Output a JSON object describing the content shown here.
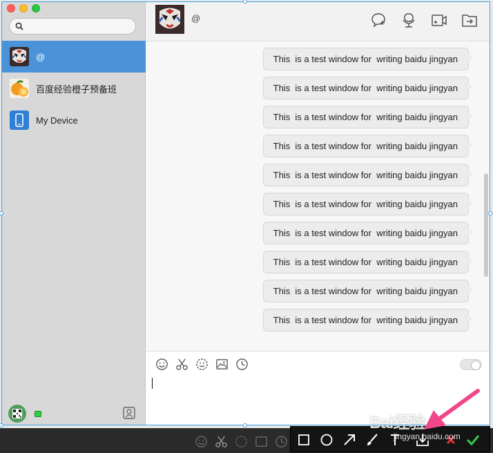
{
  "window": {
    "traffic_lights": [
      "#ff5f57",
      "#febc2e",
      "#28c840"
    ],
    "accent": "#4a93d9"
  },
  "sidebar": {
    "search": {
      "placeholder": "",
      "icon": "search-icon"
    },
    "chats": [
      {
        "name": "@",
        "avatar": "opera-mask-avatar",
        "active": true
      },
      {
        "name": "百度经验橙子预备班",
        "avatar": "orange-avatar",
        "active": false
      },
      {
        "name": "My Device",
        "avatar": "phone-icon",
        "active": false
      }
    ],
    "footer": {
      "status_color": "#2ecc40",
      "contacts_icon": "contacts-icon"
    }
  },
  "chat": {
    "title": "@",
    "header_icons": [
      "add-chat-icon",
      "microphone-icon",
      "video-call-icon",
      "file-transfer-icon"
    ],
    "messages": [
      "This  is a test window for  writing baidu jingyan",
      "This  is a test window for  writing baidu jingyan",
      "This  is a test window for  writing baidu jingyan",
      "This  is a test window for  writing baidu jingyan",
      "This  is a test window for  writing baidu jingyan",
      "This  is a test window for  writing baidu jingyan",
      "This  is a test window for  writing baidu jingyan",
      "This  is a test window for  writing baidu jingyan",
      "This  is a test window for  writing baidu jingyan",
      "This  is a test window for  writing baidu jingyan"
    ],
    "composer_tools": [
      "emoji-icon",
      "scissors-icon",
      "sticker-icon",
      "image-icon",
      "history-icon"
    ]
  },
  "screenshot_toolbar": {
    "tools": [
      "rectangle-tool-icon",
      "ellipse-tool-icon",
      "arrow-tool-icon",
      "brush-tool-icon",
      "text-tool-icon",
      "save-icon",
      "cancel-icon",
      "confirm-icon"
    ]
  },
  "watermark": {
    "brand": "Bai经验",
    "url": "jingyan.baidu.com"
  }
}
